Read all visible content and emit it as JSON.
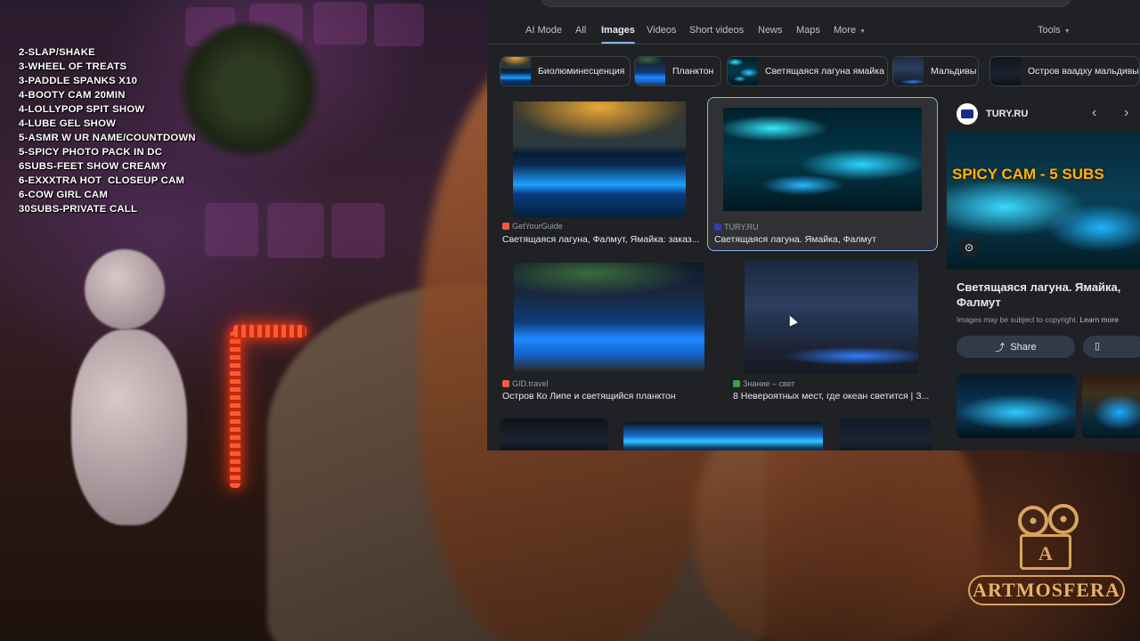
{
  "menu": {
    "lines": [
      "2-SLAP/SHAKE",
      "3-WHEEL OF TREATS",
      "3-PADDLE SPANKS X10",
      "4-BOOTY CAM 20MIN",
      "4-LOLLYPOP SPIT SHOW",
      "4-LUBE GEL SHOW",
      "5-ASMR W UR NAME/COUNTDOWN",
      "5-SPICY PHOTO PACK IN DC",
      "6SUBS-FEET SHOW CREAMY",
      "6-EXXXTRA HOT  CLOSEUP CAM",
      "6-COW GIRL CAM",
      "30SUBS-PRIVATE CALL"
    ]
  },
  "browser": {
    "tabs": [
      "AI Mode",
      "All",
      "Images",
      "Videos",
      "Short videos",
      "News",
      "Maps",
      "More"
    ],
    "active_tab": "Images",
    "tools_label": "Tools",
    "chips": [
      "Биолюминесценция",
      "Планктон",
      "Светящаяся лагуна ямайка",
      "Мальдивы",
      "Остров ваадху мальдивы"
    ],
    "results": [
      {
        "source": "GetYourGuide",
        "title": "Светящаяся лагуна, Фалмут, Ямайка: заказ..."
      },
      {
        "source": "TURY.RU",
        "title": "Светящаяся лагуна. Ямайка, Фалмут"
      },
      {
        "source": "GID.travel",
        "title": "Остров Ко Липе и светящийся планктон"
      },
      {
        "source": "Знание – свет",
        "title": "8 Невероятных мест, где океан светится | З..."
      }
    ],
    "side_panel": {
      "site": "TURY.RU",
      "promo_text": "SPICY CAM - 5 SUBS",
      "title": "Светящаяся лагуна. Ямайка, Фалмут",
      "copyright": "Images may be subject to copyright.",
      "learn_more": "Learn more",
      "share_label": "Share",
      "prev_icon": "chevron-left-icon",
      "next_icon": "chevron-right-icon"
    }
  },
  "brand": {
    "letter": "A",
    "name": "ARTMOSFERA"
  },
  "colors": {
    "accent": "#8ab4f8",
    "promo": "#f4b51a",
    "brand_gold": "#d9a45c",
    "led_red": "#ff3b1a"
  }
}
